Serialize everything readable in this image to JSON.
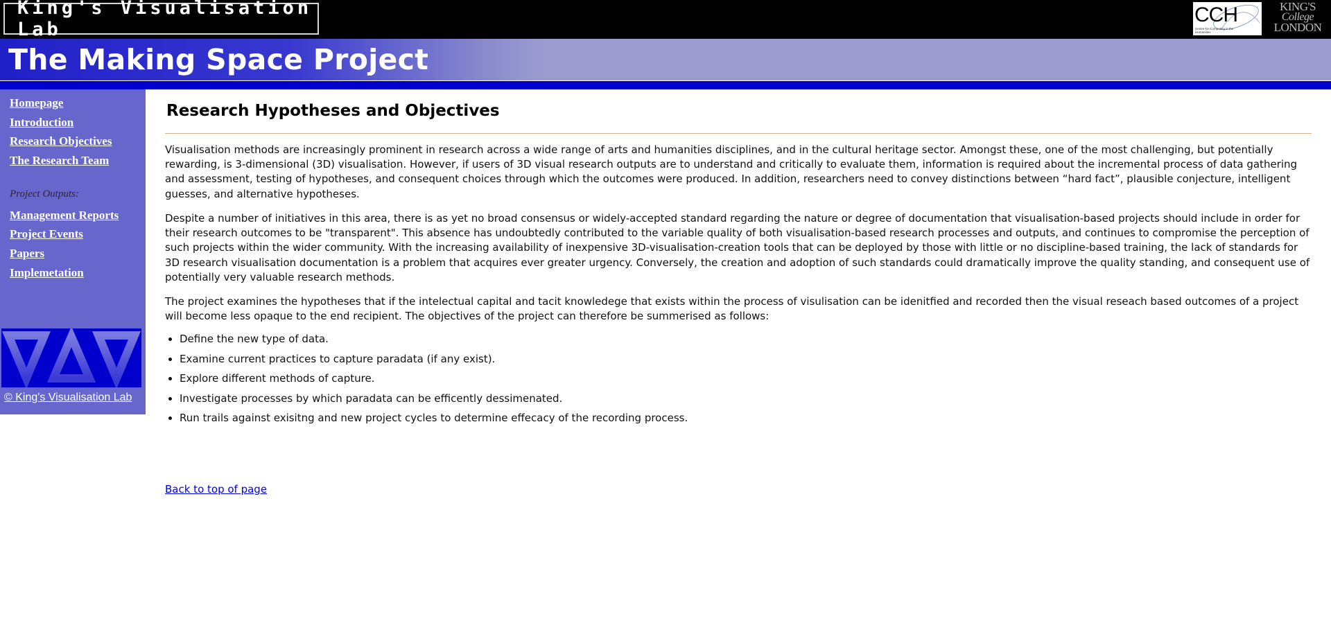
{
  "header": {
    "lab_name": "King's Visualisation Lab",
    "cch_logo_text": "CCH",
    "cch_logo_subtext": "Centre for Computing in the Humanities",
    "kings_logo_lines": [
      "KING'S",
      "College",
      "LONDON"
    ]
  },
  "banner": {
    "title": "The Making Space Project"
  },
  "sidebar": {
    "nav_primary": [
      {
        "label": "Homepage"
      },
      {
        "label": "Introduction"
      },
      {
        "label": "Research Objectives"
      },
      {
        "label": "The Research Team"
      }
    ],
    "outputs_heading": "Project Outputs:",
    "nav_outputs": [
      {
        "label": "Management Reports"
      },
      {
        "label": "Project Events"
      },
      {
        "label": "Papers"
      },
      {
        "label": "Implemetation"
      }
    ],
    "copyright": "© King's Visualisation Lab"
  },
  "main": {
    "title": "Research Hypotheses and Objectives",
    "paragraphs": [
      "Visualisation methods are increasingly prominent in research across a wide range of arts and humanities disciplines, and in the cultural heritage sector. Amongst these, one of the most challenging, but potentially rewarding, is 3-dimensional (3D) visualisation. However, if users of 3D visual research outputs are to understand and critically to evaluate them, information is required about the incremental process of data gathering and assessment, testing of hypotheses, and consequent choices through which the outcomes were produced. In addition, researchers need to convey distinctions between “hard fact”, plausible conjecture, intelligent guesses, and alternative hypotheses.",
      "Despite a number of initiatives in this area, there is as yet no broad consensus or widely-accepted standard regarding the nature or degree of documentation that visualisation-based projects should include in order for their research outcomes to be \"transparent\". This absence has undoubtedly contributed to the variable quality of both visualisation-based research processes and outputs, and continues to compromise the perception of such projects within the wider community. With the increasing availability of inexpensive 3D-visualisation-creation tools that can be deployed by those with little or no discipline-based training, the lack of standards for 3D research visualisation documentation is a problem that acquires ever greater urgency. Conversely, the creation and adoption of such standards could dramatically improve the quality standing, and consequent use of potentially very valuable research methods.",
      "The project examines the hypotheses that if the intelectual capital and tacit knowledege that exists within the process of visulisation can be idenitfied and recorded then the visual reseach based outcomes of a project will become less opaque to the end recipient. The objectives of the project can therefore be summerised as follows:"
    ],
    "objectives": [
      "Define the new type of data.",
      "Examine current practices to capture paradata (if any exist).",
      "Explore different methods of capture.",
      "Investigate processes by which paradata can be efficently dessimenated.",
      "Run trails against exisitng and new project cycles to determine effecacy of the recording process."
    ],
    "back_to_top": "Back to top of page"
  },
  "colors": {
    "header_bg": "#000000",
    "banner_blue": "#2020c8",
    "banner_lavender": "#9b9bd0",
    "strip_blue": "#0000cc",
    "sidebar_bg": "#6666cc",
    "rule": "#d9b38c",
    "link": "#0000ee"
  }
}
